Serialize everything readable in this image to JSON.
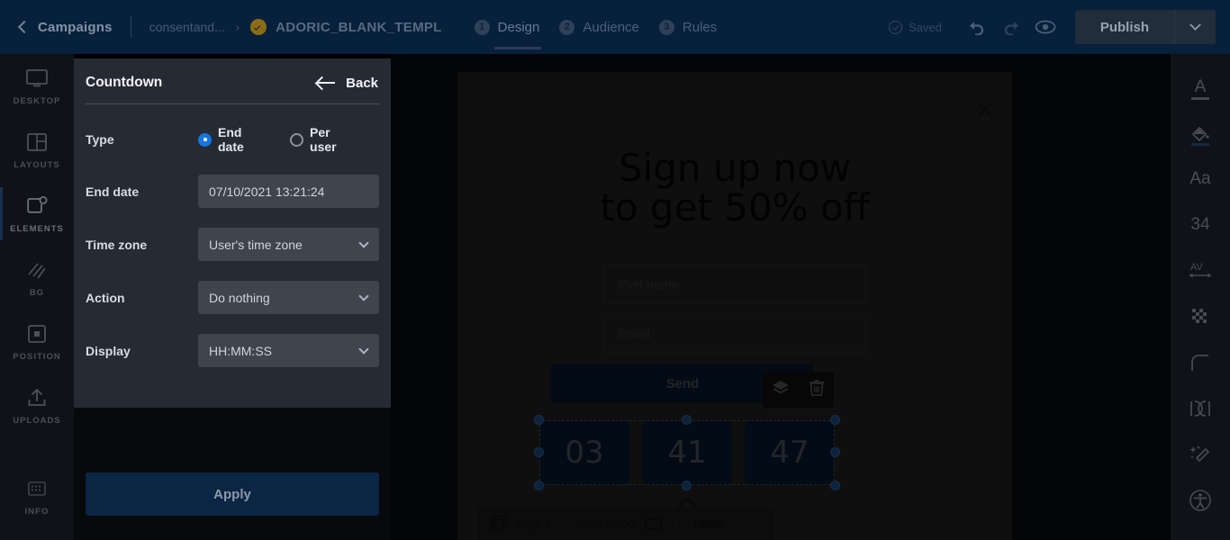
{
  "header": {
    "back_label": "",
    "breadcrumb_root": "Campaigns",
    "breadcrumb_parent": "consentand...",
    "breadcrumb_arrow": "›",
    "breadcrumb_current": "ADORIC_BLANK_TEMPL",
    "steps": [
      {
        "num": "1",
        "label": "Design",
        "active": true
      },
      {
        "num": "2",
        "label": "Audience",
        "active": false
      },
      {
        "num": "3",
        "label": "Rules",
        "active": false
      }
    ],
    "saved_label": "Saved",
    "publish_label": "Publish"
  },
  "left_rail": [
    {
      "label": "DESKTOP",
      "icon": "monitor-icon",
      "active": false
    },
    {
      "label": "LAYOUTS",
      "icon": "layouts-icon",
      "active": false
    },
    {
      "label": "ELEMENTS",
      "icon": "elements-icon",
      "active": true
    },
    {
      "label": "BG",
      "icon": "background-icon",
      "active": false
    },
    {
      "label": "POSITION",
      "icon": "position-icon",
      "active": false
    },
    {
      "label": "UPLOADS",
      "icon": "upload-icon",
      "active": false
    },
    {
      "label": "INFO",
      "icon": "info-icon",
      "active": false
    }
  ],
  "panel": {
    "title": "Countdown",
    "back_label": "Back",
    "type_label": "Type",
    "type_options": [
      {
        "label": "End date",
        "selected": true
      },
      {
        "label": "Per user",
        "selected": false
      }
    ],
    "end_date_label": "End date",
    "end_date_value": "07/10/2021 13:21:24",
    "time_zone_label": "Time zone",
    "time_zone_value": "User's time zone",
    "action_label": "Action",
    "action_value": "Do nothing",
    "display_label": "Display",
    "display_value": "HH:MM:SS",
    "apply_label": "Apply"
  },
  "canvas": {
    "headline_line1": "Sign up now",
    "headline_line2": "to get 50% off",
    "first_name_placeholder": "First name",
    "email_placeholder": "Email",
    "send_label": "Send",
    "countdown_values": [
      "03",
      "41",
      "47"
    ],
    "toolbar": [
      {
        "icon": "layers-icon"
      },
      {
        "icon": "trash-icon"
      }
    ]
  },
  "statusbar": {
    "step_label": "Step 1",
    "step_number": "1",
    "dimensions": "750 × 500",
    "zoom": "100%"
  },
  "right_rail": [
    {
      "icon": "text-color-icon",
      "glyph": "A",
      "underline": "gray"
    },
    {
      "icon": "fill-color-icon",
      "glyph": "",
      "underline": "blue"
    },
    {
      "icon": "font-family-icon",
      "glyph": "Aa",
      "underline": ""
    },
    {
      "icon": "font-size-icon",
      "glyph": "34",
      "underline": ""
    },
    {
      "icon": "letter-spacing-icon",
      "glyph": "AV",
      "underline": ""
    },
    {
      "icon": "opacity-icon",
      "glyph": "",
      "underline": ""
    },
    {
      "icon": "border-radius-icon",
      "glyph": "",
      "underline": ""
    },
    {
      "icon": "padding-icon",
      "glyph": "",
      "underline": ""
    },
    {
      "icon": "effects-icon",
      "glyph": "",
      "underline": ""
    },
    {
      "icon": "accessibility-icon",
      "glyph": "",
      "underline": ""
    }
  ],
  "colors": {
    "header_bg": "#07203c",
    "accent_blue": "#1576e0",
    "panel_bg": "#262a33",
    "field_bg": "#3f444e",
    "apply_bg": "#0b2545",
    "countdown_box": "#0c2a50"
  }
}
